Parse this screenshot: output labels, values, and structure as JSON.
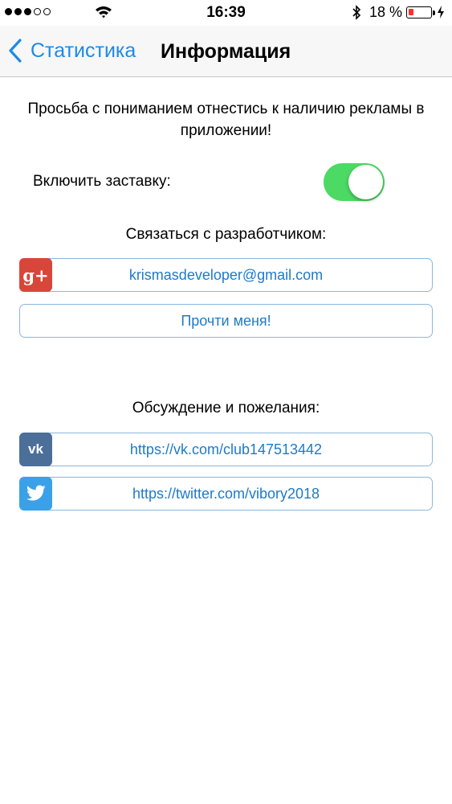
{
  "status_bar": {
    "time": "16:39",
    "battery_percent": "18 %",
    "signal_bars": 3,
    "signal_total": 5
  },
  "nav": {
    "back_label": "Статистика",
    "title": "Информация",
    "accent_color": "#1e8ae6"
  },
  "content": {
    "notice": "Просьба с пониманием отнестись к наличию рекламы в приложении!",
    "screensaver_label": "Включить заставку:",
    "screensaver_enabled": true,
    "contact_title": "Связаться с разработчиком:",
    "email": "krismasdeveloper@gmail.com",
    "readme_label": "Прочти меня!",
    "discuss_title": "Обсуждение и пожелания:",
    "vk_link": "https://vk.com/club147513442",
    "twitter_link": "https://twitter.com/vibory2018"
  },
  "icons": {
    "gplus": "google-plus-icon",
    "vk": "vk-icon",
    "twitter": "twitter-icon",
    "gplus_label": "g+",
    "vk_label": "vk"
  },
  "colors": {
    "toggle_on": "#4cd964",
    "link_text": "#1e7ac8",
    "link_border": "#8cb6dc",
    "gplus": "#d8463a",
    "vk": "#4c6f9a",
    "twitter": "#3aa1e8",
    "battery_low": "#ff2d2d"
  }
}
